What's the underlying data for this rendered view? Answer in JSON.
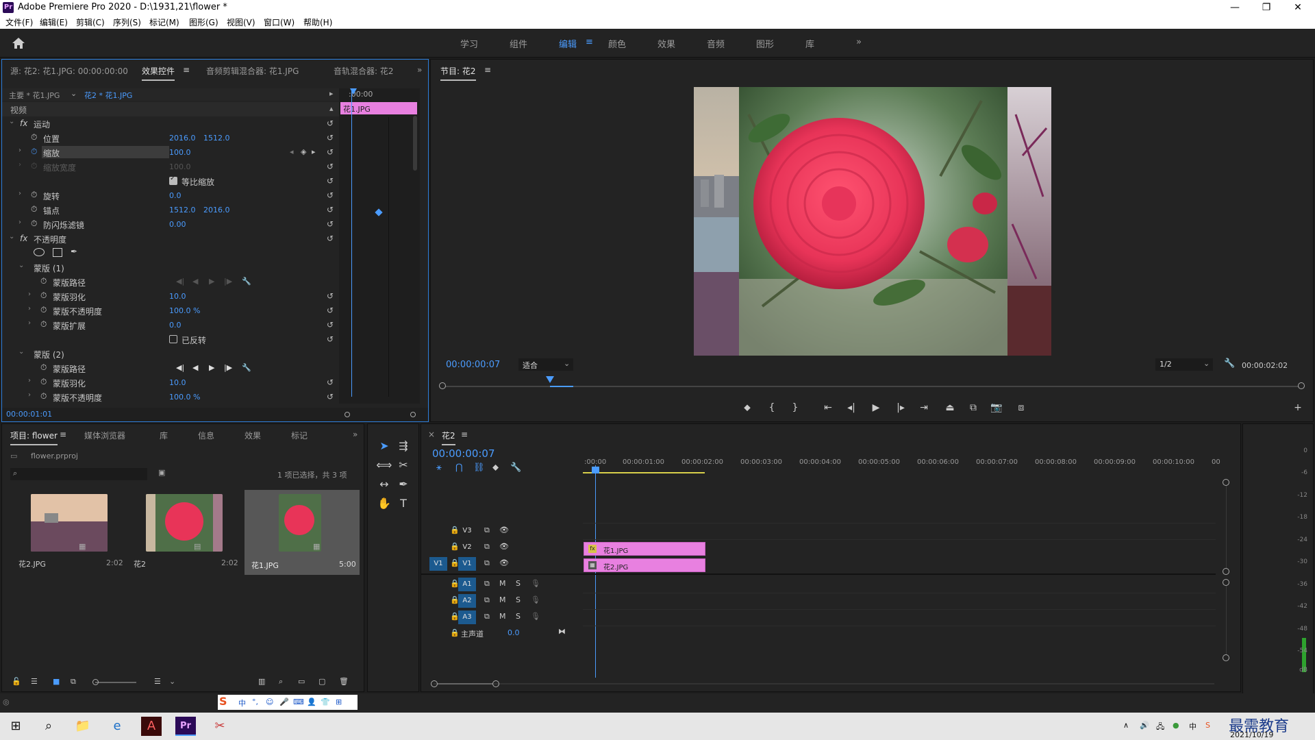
{
  "app": {
    "title": "Adobe Premiere Pro 2020 - D:\\1931,21\\flower *",
    "logo": "Pr",
    "window_controls": [
      "—",
      "❐",
      "✕"
    ]
  },
  "menu": [
    "文件(F)",
    "编辑(E)",
    "剪辑(C)",
    "序列(S)",
    "标记(M)",
    "图形(G)",
    "视图(V)",
    "窗口(W)",
    "帮助(H)"
  ],
  "workspaces": {
    "items": [
      "学习",
      "组件",
      "编辑",
      "颜色",
      "效果",
      "音频",
      "图形",
      "库"
    ],
    "active_index": 2,
    "more": "»"
  },
  "effect_panel": {
    "tabs": [
      "源: 花2: 花1.JPG: 00:00:00:00",
      "效果控件",
      "音频剪辑混合器: 花1.JPG",
      "音轨混合器: 花2"
    ],
    "active_tab": 1,
    "master": "主要 * 花1.JPG",
    "sequence_clip": "花2 * 花1.JPG",
    "ruler_time": ":00:00",
    "clip_label": "花1.JPG",
    "section_video": "视频",
    "motion": "运动",
    "position_label": "位置",
    "position_x": "2016.0",
    "position_y": "1512.0",
    "scale_label": "缩放",
    "scale_value": "100.0",
    "scale_width_label": "缩放宽度",
    "scale_width_value": "100.0",
    "uniform_scale_label": "等比缩放",
    "rotation_label": "旋转",
    "rotation_value": "0.0",
    "anchor_label": "锚点",
    "anchor_x": "1512.0",
    "anchor_y": "2016.0",
    "antiflicker_label": "防闪烁滤镜",
    "antiflicker_value": "0.00",
    "opacity_label": "不透明度",
    "mask1": "蒙版 (1)",
    "mask2": "蒙版 (2)",
    "mask_path_label": "蒙版路径",
    "mask_feather_label": "蒙版羽化",
    "mask_feather_value": "10.0",
    "mask_opacity_label": "蒙版不透明度",
    "mask_opacity_value": "100.0 %",
    "mask_expand_label": "蒙版扩展",
    "mask_expand_value": "0.0",
    "inverted_label": "已反转",
    "timecode": "00:00:01:01"
  },
  "program": {
    "title": "节目: 花2",
    "timecode": "00:00:00:07",
    "fit": "适合",
    "quality": "1/2",
    "duration": "00:00:02:02"
  },
  "project": {
    "tabs": [
      "项目: flower",
      "媒体浏览器",
      "库",
      "信息",
      "效果",
      "标记"
    ],
    "file": "flower.prproj",
    "selection_info": "1 项已选择，共 3 项",
    "items": [
      {
        "name": "花2.JPG",
        "duration": "2:02"
      },
      {
        "name": "花2",
        "duration": "2:02"
      },
      {
        "name": "花1.JPG",
        "duration": "5:00"
      }
    ]
  },
  "timeline": {
    "title": "花2",
    "timecode": "00:00:00:07",
    "ruler": [
      ":00:00",
      "00:00:01:00",
      "00:00:02:00",
      "00:00:03:00",
      "00:00:04:00",
      "00:00:05:00",
      "00:00:06:00",
      "00:00:07:00",
      "00:00:08:00",
      "00:00:09:00",
      "00:00:10:00",
      "00"
    ],
    "video_tracks": [
      "V3",
      "V2",
      "V1"
    ],
    "audio_tracks": [
      "A1",
      "A2",
      "A3"
    ],
    "source_patch": "V1",
    "master_label": "主声道",
    "master_value": "0.0",
    "clip_v2": "花1.JPG",
    "clip_v1": "花2.JPG",
    "m": "M",
    "s": "S"
  },
  "meter": {
    "labels": [
      "0",
      "-6",
      "-12",
      "-18",
      "-24",
      "-30",
      "-36",
      "-42",
      "-48",
      "-54",
      "dB"
    ]
  },
  "ime": {
    "lang": "中"
  },
  "taskbar": {
    "date": "2021/10/19",
    "watermark": "最需教育"
  },
  "colors": {
    "accent": "#4b9cff",
    "clip": "#e880e0",
    "panel": "#232323",
    "focus": "#2d7fdc"
  }
}
